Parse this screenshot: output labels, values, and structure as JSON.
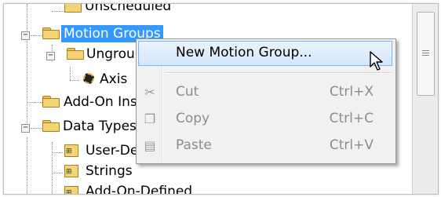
{
  "tree": {
    "nodes": [
      {
        "label": "Unscheduled"
      },
      {
        "label": "Motion Groups"
      },
      {
        "label": "Ungrouped Axes"
      },
      {
        "label": "Axis"
      },
      {
        "label": "Add-On Instructions"
      },
      {
        "label": "Data Types"
      },
      {
        "label": "User-Defined"
      },
      {
        "label": "Strings"
      },
      {
        "label": "Add-On-Defined"
      }
    ],
    "expanders": [
      "−",
      "−",
      "−"
    ]
  },
  "context_menu": {
    "items": [
      {
        "label": "New Motion Group...",
        "shortcut": "",
        "icon": "",
        "enabled": true
      },
      {
        "label": "Cut",
        "shortcut": "Ctrl+X",
        "icon": "scissors-icon",
        "enabled": false
      },
      {
        "label": "Copy",
        "shortcut": "Ctrl+C",
        "icon": "copy-icon",
        "enabled": false
      },
      {
        "label": "Paste",
        "shortcut": "Ctrl+V",
        "icon": "paste-icon",
        "enabled": false
      }
    ]
  },
  "colors": {
    "selection": "#3399ff",
    "folder": "#f2d476",
    "menu_hover": "#dceafd"
  }
}
